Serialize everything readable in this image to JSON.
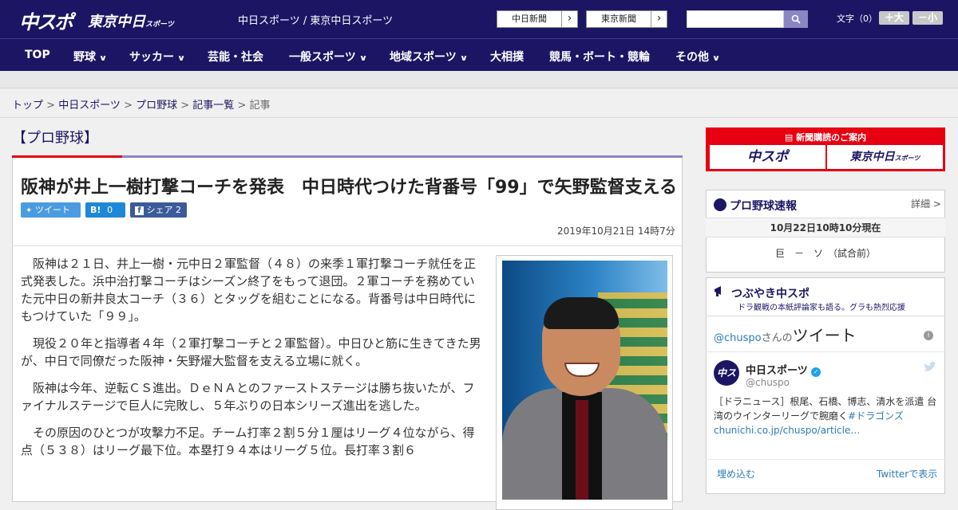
{
  "header": {
    "logo_main": "中スポ",
    "logo_sub": "東京中日",
    "logo_sub_small": "スポーツ",
    "site_title": "中日スポーツ / 東京中日スポーツ",
    "btn_chunichi": "中日新聞",
    "btn_tokyo": "東京新聞",
    "arrow": "›",
    "search_placeholder": "",
    "font_label": "文字（0）",
    "font_plus": "＋大",
    "font_minus": "－小"
  },
  "nav": {
    "items": [
      {
        "label": "TOP",
        "dd": ""
      },
      {
        "label": "野球",
        "dd": "∨"
      },
      {
        "label": "サッカー",
        "dd": "∨"
      },
      {
        "label": "芸能・社会",
        "dd": ""
      },
      {
        "label": "一般スポーツ",
        "dd": "∨"
      },
      {
        "label": "地域スポーツ",
        "dd": "∨"
      },
      {
        "label": "大相撲",
        "dd": ""
      },
      {
        "label": "競馬・ボート・競輪",
        "dd": ""
      },
      {
        "label": "その他",
        "dd": "∨"
      }
    ]
  },
  "breadcrumb": {
    "items": [
      "トップ",
      "中日スポーツ",
      "プロ野球",
      "記事一覧"
    ],
    "current": "記事",
    "sep": " > "
  },
  "article": {
    "category": "【プロ野球】",
    "title": "阪神が井上一樹打撃コーチを発表　中日時代つけた背番号「99」で矢野監督支える",
    "tweet": "ツイート",
    "hatena": "B!",
    "hatena_count": "0",
    "fb": "シェア",
    "fb_count": "2",
    "date": "2019年10月21日 14時7分",
    "paragraphs": [
      "阪神は２１日、井上一樹・元中日２軍監督（４８）の来季１軍打撃コーチ就任を正式発表した。浜中治打撃コーチはシーズン終了をもって退団。２軍コーチを務めていた元中日の新井良太コーチ（３６）とタッグを組むことになる。背番号は中日時代にもつけていた「９９」。",
      "現役２０年と指導者４年（２軍打撃コーチと２軍監督）。中日ひと筋に生きてきた男が、中日で同僚だった阪神・矢野燿大監督を支える立場に就く。",
      "阪神は今年、逆転ＣＳ進出。ＤｅＮＡとのファーストステージは勝ち抜いたが、ファイナルステージで巨人に完敗し、５年ぶりの日本シリーズ進出を逃した。",
      "その原因のひとつが攻撃力不足。チーム打率２割５分１厘はリーグ４位ながら、得点（５３８）はリーグ最下位。本塁打９４本はリーグ５位。長打率３割６"
    ]
  },
  "sidebar": {
    "ad_head": "新聞購読のご案内",
    "ad_b1": "中スポ",
    "ad_b2": "東京中日",
    "ad_b2_small": "スポーツ",
    "sokuhou_title": "プロ野球速報",
    "sokuhou_detail": "詳細 >",
    "sokuhou_time": "10月22日10時10分現在",
    "sokuhou_game": "巨　－　ソ　（試合前）",
    "tsubuyaki_title": "つぶやき中スポ",
    "tsubuyaki_sub": "ドラ観戦の本紙評論家も語る。グラも熱烈応援",
    "tw_handle": "@chuspo",
    "tw_suffix": "さんの",
    "tw_big": "ツイート",
    "tw_name": "中日スポーツ",
    "tw_user": "@chuspo",
    "tw_text": "［ドラニュース］根尾、石橋、博志、清水を派遣 台湾のウインターリーグで腕磨く",
    "tw_link": "#ドラゴンズchunichi.co.jp/chuspo/article…",
    "tw_embed": "埋め込む",
    "tw_view": "Twitterで表示"
  }
}
